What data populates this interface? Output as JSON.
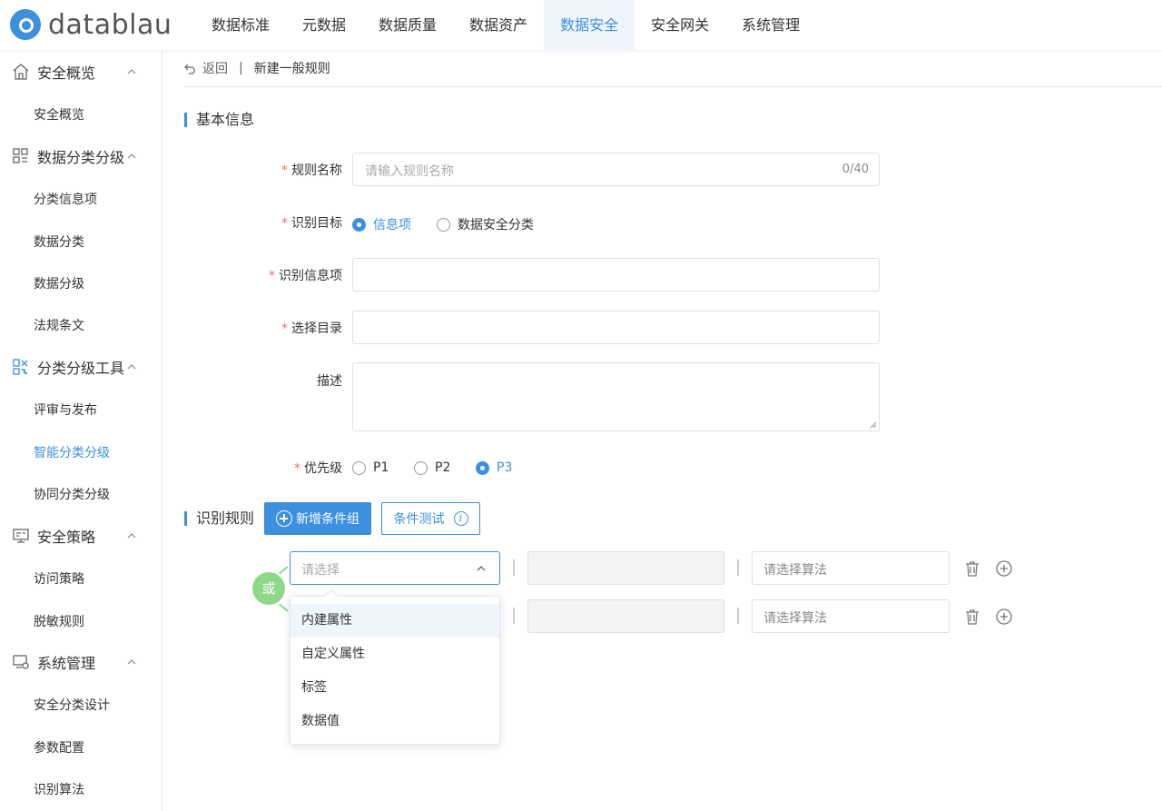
{
  "app": {
    "brand": "datablau"
  },
  "nav": [
    "数据标准",
    "元数据",
    "数据质量",
    "数据资产",
    "数据安全",
    "安全网关",
    "系统管理"
  ],
  "nav_active": "数据安全",
  "sidebar": {
    "groups": [
      {
        "label": "安全概览",
        "icon": "home-icon",
        "items": [
          "安全概览"
        ]
      },
      {
        "label": "数据分类分级",
        "icon": "grid-icon",
        "items": [
          "分类信息项",
          "数据分类",
          "数据分级",
          "法规条文"
        ]
      },
      {
        "label": "分类分级工具",
        "icon": "tools-icon",
        "items": [
          "评审与发布",
          "智能分类分级",
          "协同分类分级"
        ]
      },
      {
        "label": "安全策略",
        "icon": "policy-icon",
        "items": [
          "访问策略",
          "脱敏规则"
        ]
      },
      {
        "label": "系统管理",
        "icon": "monitor-gear-icon",
        "items": [
          "安全分类设计",
          "参数配置",
          "识别算法"
        ]
      }
    ],
    "active_item": "智能分类分级"
  },
  "breadcrumb": {
    "back": "返回",
    "separator": "|",
    "current": "新建一般规则"
  },
  "basic_info": {
    "title": "基本信息",
    "rule_name": {
      "label": "规则名称",
      "placeholder": "请输入规则名称",
      "count": "0/40"
    },
    "target": {
      "label": "识别目标",
      "options": [
        "信息项",
        "数据安全分类"
      ],
      "selected": "信息项"
    },
    "info_item": {
      "label": "识别信息项",
      "value": ""
    },
    "directory": {
      "label": "选择目录",
      "value": ""
    },
    "description": {
      "label": "描述",
      "value": ""
    },
    "priority": {
      "label": "优先级",
      "options": [
        "P1",
        "P2",
        "P3"
      ],
      "selected": "P3"
    }
  },
  "rules": {
    "title": "识别规则",
    "add_group_label": "新增条件组",
    "test_label": "条件测试",
    "or_label": "或",
    "select_placeholder": "请选择",
    "algo_placeholder": "请选择算法",
    "dropdown_options": [
      "内建属性",
      "自定义属性",
      "标签",
      "数据值"
    ],
    "dropdown_hover": "内建属性"
  },
  "colors": {
    "accent": "#3d8fe0",
    "required": "#f56c6c",
    "or_badge": "#8ed88a"
  }
}
